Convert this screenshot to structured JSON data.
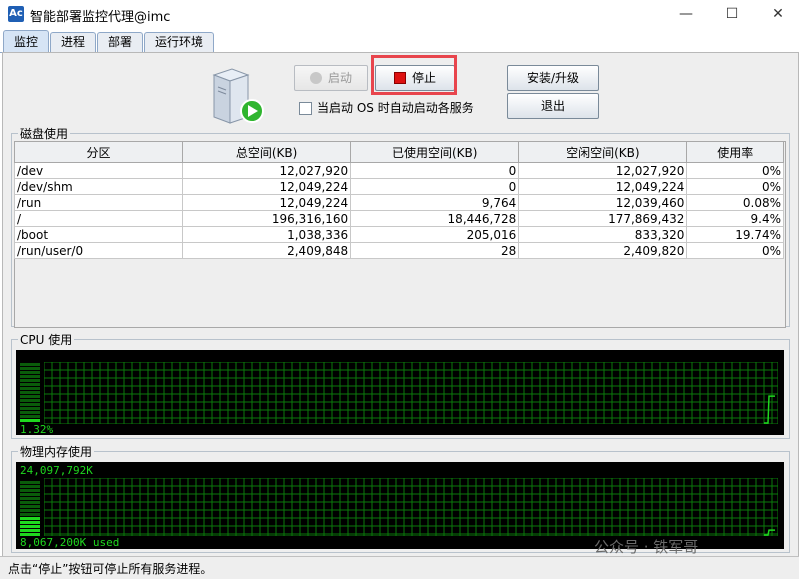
{
  "window": {
    "app_icon_text": "Ac",
    "title": "智能部署监控代理@imc",
    "minimize": "—",
    "maximize": "☐",
    "close": "✕"
  },
  "tabs": [
    {
      "label": "监控",
      "active": true
    },
    {
      "label": "进程",
      "active": false
    },
    {
      "label": "部署",
      "active": false
    },
    {
      "label": "运行环境",
      "active": false
    }
  ],
  "controls": {
    "start_label": "启动",
    "stop_label": "停止",
    "install_label": "安装/升级",
    "exit_label": "退出",
    "autostart_label": "当启动 OS 时自动启动各服务"
  },
  "disk": {
    "group_label": "磁盘使用",
    "columns": [
      "分区",
      "总空间(KB)",
      "已使用空间(KB)",
      "空闲空间(KB)",
      "使用率"
    ],
    "rows": [
      [
        "/dev",
        "12,027,920",
        "0",
        "12,027,920",
        "0%"
      ],
      [
        "/dev/shm",
        "12,049,224",
        "0",
        "12,049,224",
        "0%"
      ],
      [
        "/run",
        "12,049,224",
        "9,764",
        "12,039,460",
        "0.08%"
      ],
      [
        "/",
        "196,316,160",
        "18,446,728",
        "177,869,432",
        "9.4%"
      ],
      [
        "/boot",
        "1,038,336",
        "205,016",
        "833,320",
        "19.74%"
      ],
      [
        "/run/user/0",
        "2,409,848",
        "28",
        "2,409,820",
        "0%"
      ]
    ]
  },
  "cpu": {
    "group_label": "CPU 使用",
    "usage_text": "1.32%",
    "usage_fraction": 0.0132
  },
  "memory": {
    "group_label": "物理内存使用",
    "total_text": "24,097,792K",
    "used_text": "8,067,200K used",
    "used_fraction": 0.335
  },
  "colors": {
    "monitor_green": "#1fd81f",
    "grid_green": "#0b7a0b",
    "highlight_red": "#e8454d"
  },
  "status": {
    "text": "点击“停止”按钮可停止所有服务进程。"
  },
  "watermark": "公众号 · 铁军哥"
}
